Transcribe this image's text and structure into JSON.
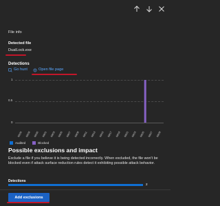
{
  "panel": {
    "section_label": "File info",
    "detected_file_label": "Detected file",
    "file_name": "DualLock.exe",
    "detections_heading": "Detections",
    "links": {
      "go_hunt": "Go hunt",
      "open_file_page": "Open file page"
    }
  },
  "chart_data": {
    "type": "bar",
    "title": "",
    "xlabel": "",
    "ylabel": "",
    "ylim": [
      0,
      1
    ],
    "yticks": [
      "0",
      "0.5",
      "1"
    ],
    "categories": [
      "08/26",
      "08/28",
      "08/30",
      "09/01",
      "09/03",
      "09/05",
      "09/07",
      "09/09",
      "09/11",
      "09/13",
      "09/15",
      "09/17",
      "09/19",
      "09/21",
      "09/23",
      "09/25",
      "09/27",
      "09/29"
    ],
    "series": [
      {
        "name": "Audited",
        "color": "#0f6fd3",
        "values": [
          0,
          0,
          0,
          0,
          0,
          0,
          0,
          0,
          0,
          0,
          0,
          0,
          0,
          0,
          0,
          0,
          0,
          0
        ]
      },
      {
        "name": "Blocked",
        "color": "#8661c5",
        "values": [
          0,
          0,
          0,
          0,
          0,
          0,
          0,
          0,
          0,
          0,
          0,
          0,
          0,
          0,
          0,
          1,
          0,
          0
        ]
      }
    ],
    "legend_position": "bottom-left",
    "grid": true
  },
  "exclusions": {
    "title": "Possible exclusions and impact",
    "body": "Exclude a file if you believe it is being detected incorrectly. When excluded, the file won't be blocked even if attack surface reduction rules detect it exhibiting possible attack behavior.",
    "detections_label": "Detections",
    "detections_count": "2",
    "detections_fraction": 1.0,
    "add_button_label": "Add exclusions"
  },
  "colors": {
    "background": "#262626",
    "accent_blue": "#0f6fd3",
    "link_blue": "#5aa7ff",
    "blocked_purple": "#8661c5",
    "annotation_red": "#c3162a"
  }
}
